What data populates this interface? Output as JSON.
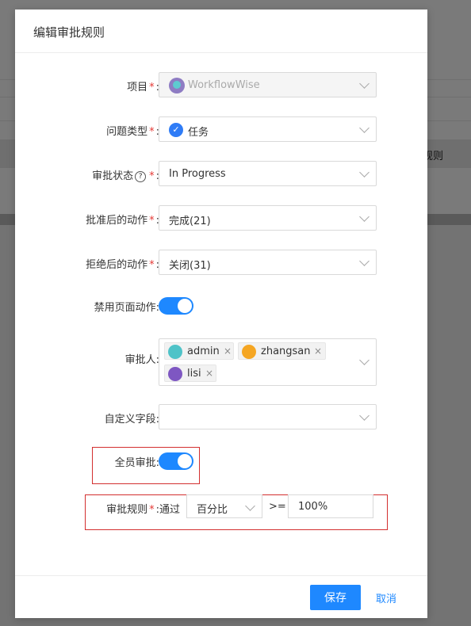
{
  "background": {
    "column_text": "规则"
  },
  "modal": {
    "title": "编辑审批规则"
  },
  "form": {
    "project": {
      "label": "项目",
      "required": "*",
      "value": "WorkflowWise"
    },
    "issue_type": {
      "label": "问题类型",
      "required": "*",
      "value": "任务"
    },
    "approval_status": {
      "label": "审批状态",
      "help": "?",
      "required": "*",
      "value": "In Progress"
    },
    "after_approve": {
      "label": "批准后的动作",
      "required": "*",
      "value": "完成(21)"
    },
    "after_reject": {
      "label": "拒绝后的动作",
      "required": "*",
      "value": "关闭(31)"
    },
    "disable_page_action": {
      "label": "禁用页面动作",
      "enabled": true
    },
    "approvers": {
      "label": "审批人",
      "items": [
        {
          "name": "admin",
          "remove": "×"
        },
        {
          "name": "zhangsan",
          "remove": "×"
        },
        {
          "name": "lisi",
          "remove": "×"
        }
      ]
    },
    "custom_field": {
      "label": "自定义字段",
      "value": ""
    },
    "all_approve": {
      "label": "全员审批",
      "enabled": true
    },
    "approval_rule": {
      "label": "审批规则",
      "required": "*",
      "pass_text": "通过",
      "mode": "百分比",
      "operator": ">=",
      "value": "100%"
    }
  },
  "colon": ":",
  "footer": {
    "save_label": "保存",
    "cancel_label": "取消"
  },
  "colors": {
    "accent": "#1e88ff",
    "required": "#e53935",
    "highlight_border": "#d32f2f"
  }
}
